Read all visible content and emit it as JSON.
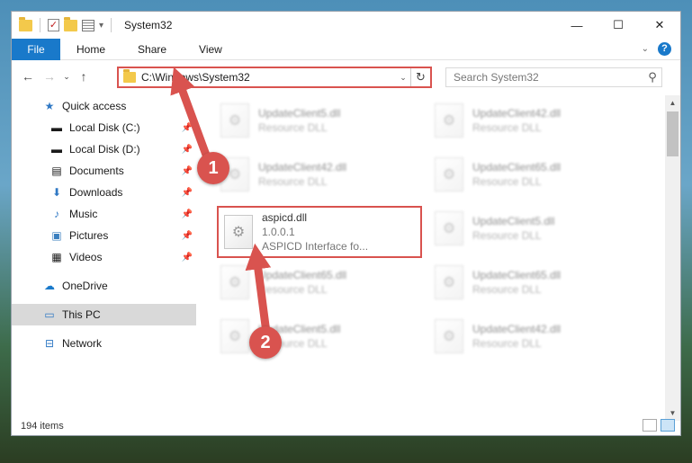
{
  "window": {
    "title": "System32"
  },
  "controls": {
    "minimize": "—",
    "maximize": "☐",
    "close": "✕"
  },
  "ribbon": {
    "file": "File",
    "tabs": [
      "Home",
      "Share",
      "View"
    ]
  },
  "address": {
    "path": "C:\\Windows\\System32",
    "search_placeholder": "Search System32"
  },
  "nav": {
    "quick_access": "Quick access",
    "items": [
      "Local Disk (C:)",
      "Local Disk (D:)",
      "Documents",
      "Downloads",
      "Music",
      "Pictures",
      "Videos"
    ],
    "onedrive": "OneDrive",
    "thispc": "This PC",
    "network": "Network"
  },
  "files": [
    {
      "name": "UpdateClient5.dll",
      "sub": "Resource DLL"
    },
    {
      "name": "UpdateClient42.dll",
      "sub": "Resource DLL"
    },
    {
      "name": "UpdateClient42.dll",
      "sub": "Resource DLL"
    },
    {
      "name": "UpdateClient65.dll",
      "sub": "Resource DLL"
    },
    {
      "name": "aspicd.dll",
      "version": "1.0.0.1",
      "sub": "ASPICD Interface fo..."
    },
    {
      "name": "UpdateClient5.dll",
      "sub": "Resource DLL"
    },
    {
      "name": "UpdateClient65.dll",
      "sub": "Resource DLL"
    },
    {
      "name": "UpdateClient65.dll",
      "sub": "Resource DLL"
    },
    {
      "name": "UpdateClient5.dll",
      "sub": "Resource DLL"
    },
    {
      "name": "UpdateClient42.dll",
      "sub": "Resource DLL"
    }
  ],
  "status": {
    "count": "194 items"
  },
  "callouts": {
    "one": "1",
    "two": "2"
  },
  "colors": {
    "accent": "#1979ca",
    "highlight": "#d9534f",
    "selected": "#d9d9d9"
  }
}
